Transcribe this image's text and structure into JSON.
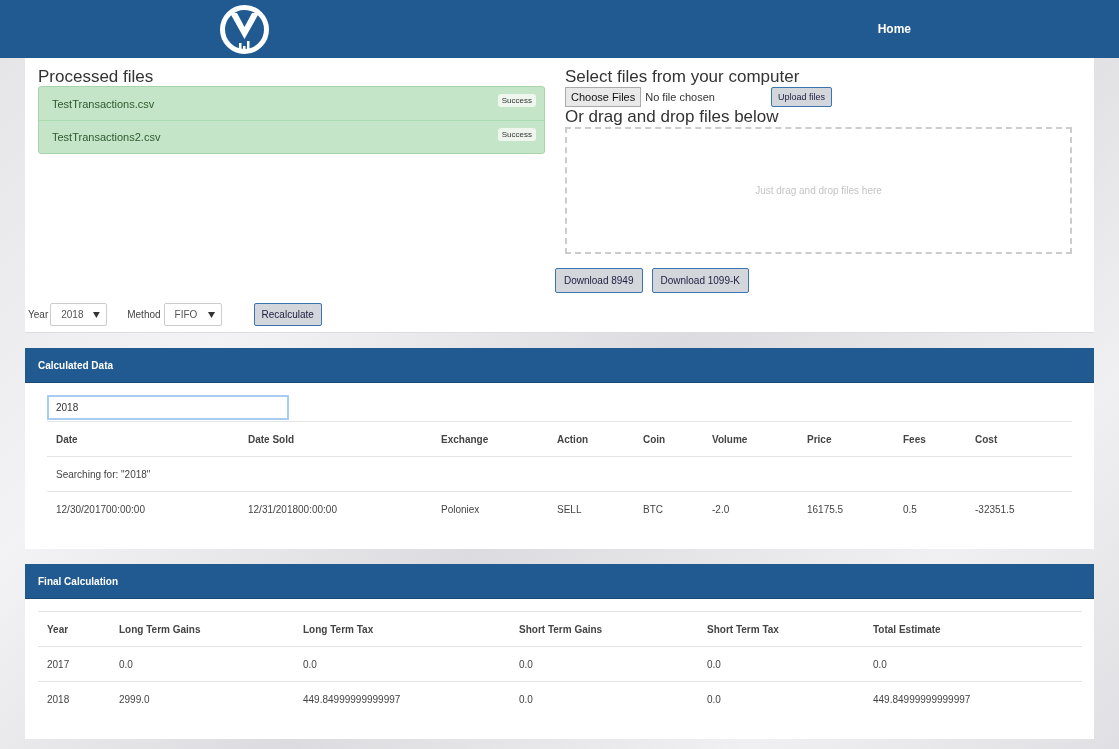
{
  "navbar": {
    "links": [
      {
        "label": "Home",
        "selected": true
      }
    ]
  },
  "processed_files": {
    "title": "Processed files",
    "files": [
      {
        "name": "TestTransactions.csv",
        "status": "Success"
      },
      {
        "name": "TestTransactions2.csv",
        "status": "Success"
      }
    ]
  },
  "upload": {
    "title": "Select files from your computer",
    "choose_button": "Choose Files",
    "file_status": "No file chosen",
    "upload_button": "Upload files",
    "drop_title": "Or drag and drop files below",
    "drop_hint": "Just drag and drop files here"
  },
  "downloads": [
    "Download 8949",
    "Download 1099-K"
  ],
  "controls": {
    "year_label": "Year",
    "year": "2018",
    "method_label": "Method",
    "method": "FIFO",
    "recalculate_button": "Recalculate"
  },
  "calculated_data": {
    "title": "Calculated Data",
    "search": {
      "value": "2018"
    },
    "columns": [
      "Date",
      "Date Sold",
      "Exchange",
      "Action",
      "Coin",
      "Volume",
      "Price",
      "Fees",
      "Cost"
    ],
    "search_note": "Searching for: \"2018\"",
    "rows": [
      [
        "12/30/201700:00:00",
        "12/31/201800:00:00",
        "Poloniex",
        "SELL",
        "BTC",
        "-2.0",
        "16175.5",
        "0.5",
        "-32351.5"
      ]
    ]
  },
  "final_calculation": {
    "title": "Final Calculation",
    "columns": [
      "Year",
      "Long Term Gains",
      "Long Term Tax",
      "Short Term Gains",
      "Short Term Tax",
      "Total Estimate"
    ],
    "rows": [
      [
        "2017",
        "0.0",
        "0.0",
        "0.0",
        "0.0",
        "0.0"
      ],
      [
        "2018",
        "2999.0",
        "449.84999999999997",
        "0.0",
        "0.0",
        "449.84999999999997"
      ]
    ]
  }
}
